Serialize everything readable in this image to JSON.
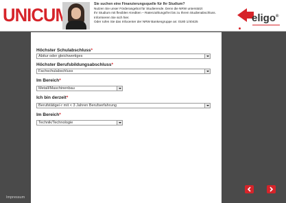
{
  "banner": {
    "logo_text": "UNICUM",
    "headline": "Sie suchen eine Finanzierungsquelle für Ihr Studium?",
    "lines": [
      "Nutzen Sie unser Förderangebot für Studierende. Denn die NRW unterstützt",
      "Ihr Studium mit flexiblen Krediten – Ratenzahlungsfrei bis zu Ihrem Studienabschluss.",
      "Informieren Sie sich hier.",
      "Oder rufen Sie das Infocenter der NRW Bankengruppe an: 0180 1/40425"
    ],
    "partner_logo_text": "eligo",
    "partner_logo_mark": "®",
    "brand_color": "#d6242a"
  },
  "form": {
    "fields": [
      {
        "label": "Höchster Schulabschluss",
        "required_mark": "*",
        "value": "Abitur oder gleichwertiges"
      },
      {
        "label": "Höchster Berufsbildungsabschluss",
        "required_mark": "*",
        "value": "Fachschulabschluss"
      },
      {
        "label": "Im Bereich",
        "required_mark": "*",
        "value": "Metall/Maschinenbau"
      },
      {
        "label": "Ich bin derzeit",
        "required_mark": "*",
        "value": "Berufstätige/-r mit < 3 Jahren Berufserfahrung"
      },
      {
        "label": "Im Bereich",
        "required_mark": "*",
        "value": "Technik/Technologie"
      }
    ]
  },
  "footer": {
    "imprint_label": "Impressum"
  },
  "navigation": {
    "back_icon": "chevron-left-icon",
    "next_icon": "chevron-right-icon"
  }
}
